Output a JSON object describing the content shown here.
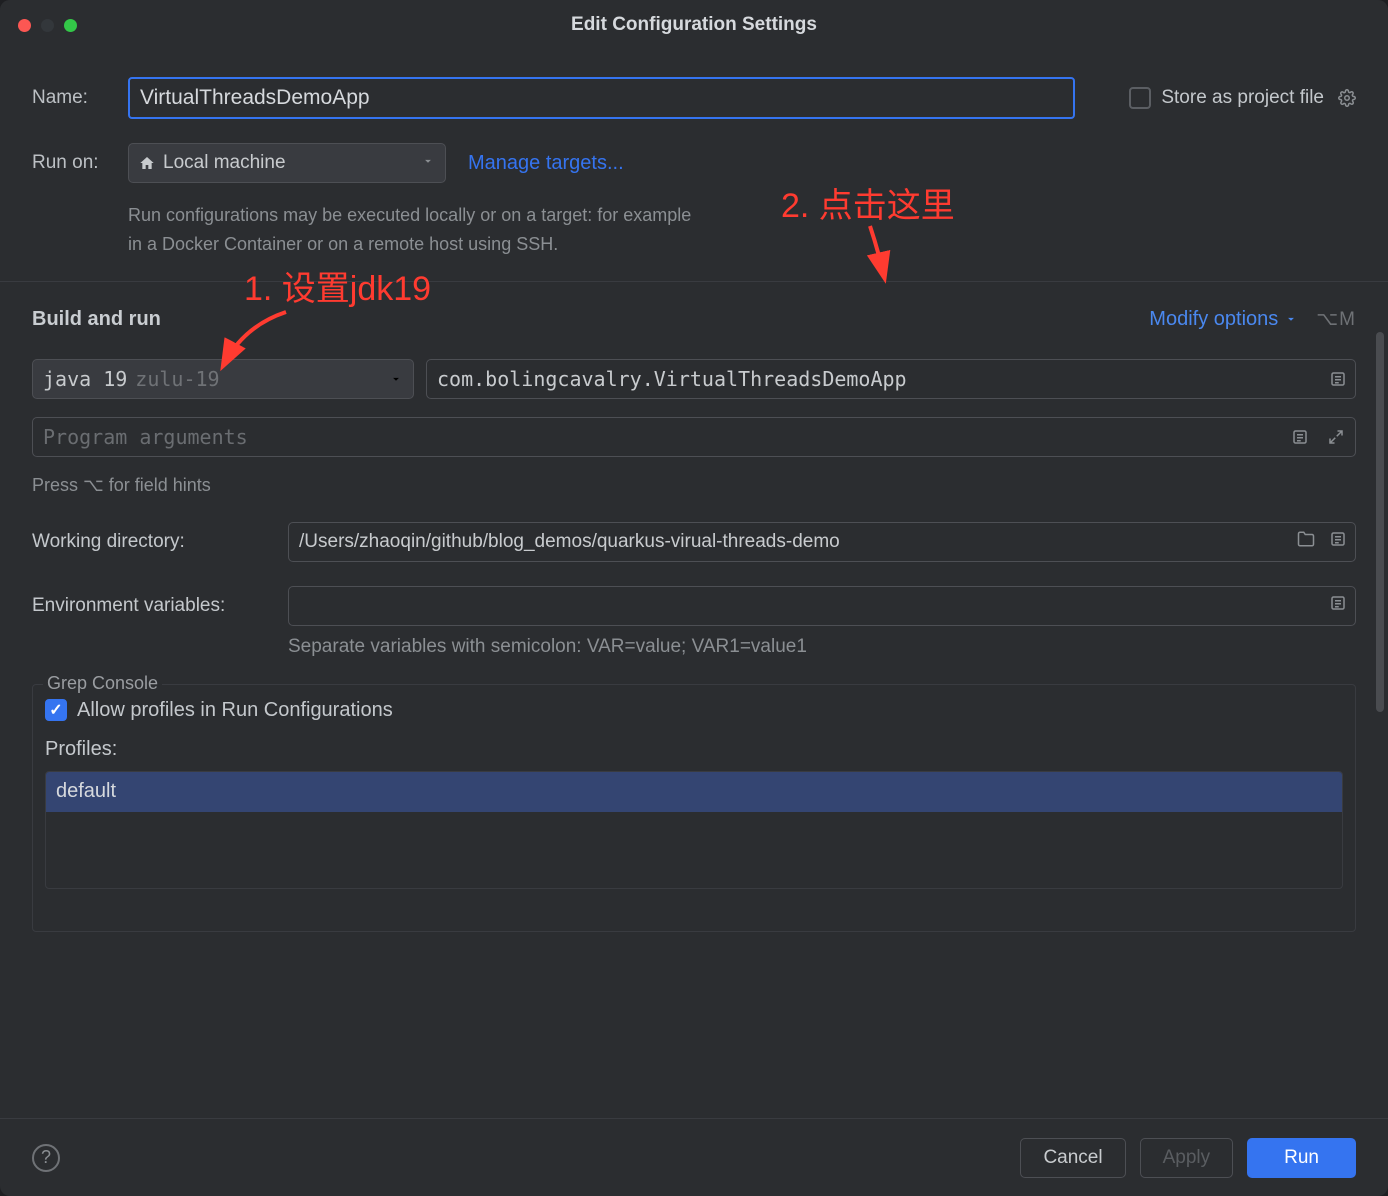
{
  "title": "Edit Configuration Settings",
  "name_label": "Name:",
  "name_value": "VirtualThreadsDemoApp",
  "store_label": "Store as project file",
  "runon_label": "Run on:",
  "runon_value": "Local machine",
  "manage_targets": "Manage targets...",
  "runon_hint": "Run configurations may be executed locally or on a target: for example in a Docker Container or on a remote host using SSH.",
  "build_and_run": "Build and run",
  "modify_options": "Modify options",
  "modify_shortcut": "⌥M",
  "jdk_name": "java 19",
  "jdk_vendor": "zulu-19",
  "main_class": "com.bolingcavalry.VirtualThreadsDemoApp",
  "args_placeholder": "Program arguments",
  "field_hints": "Press ⌥ for field hints",
  "workdir_label": "Working directory:",
  "workdir_value": "/Users/zhaoqin/github/blog_demos/quarkus-virual-threads-demo",
  "env_label": "Environment variables:",
  "env_hint": "Separate variables with semicolon: VAR=value; VAR1=value1",
  "grep_console": "Grep Console",
  "allow_profiles": "Allow profiles in Run Configurations",
  "profiles_label": "Profiles:",
  "profiles": [
    "default"
  ],
  "cancel": "Cancel",
  "apply": "Apply",
  "run": "Run",
  "annot1": "1. 设置jdk19",
  "annot2": "2. 点击这里"
}
